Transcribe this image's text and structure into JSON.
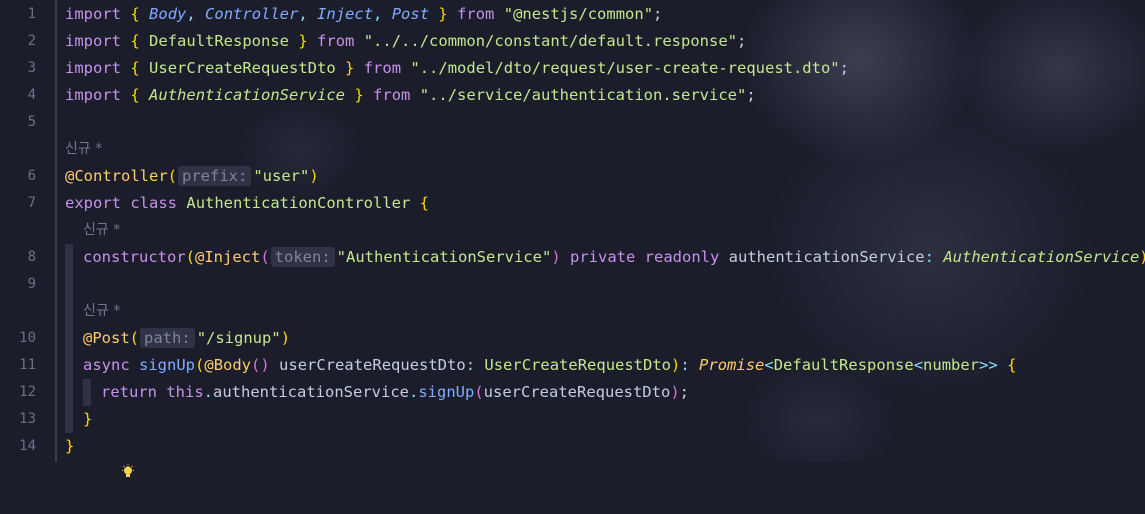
{
  "editor": {
    "line_numbers": [
      "1",
      "2",
      "3",
      "4",
      "5",
      "6",
      "7",
      "8",
      "9",
      "10",
      "11",
      "12",
      "13",
      "14"
    ],
    "codelens": "신규 *",
    "hints": {
      "prefix": "prefix:",
      "token": "token:",
      "path": "path:"
    },
    "lines": {
      "l1": {
        "import": "import",
        "brace_open": "{",
        "body": "Body",
        "controller": "Controller",
        "inject": "Inject",
        "post": "Post",
        "brace_close": "}",
        "from": "from",
        "src": "\"@nestjs/common\"",
        "semi": ";"
      },
      "l2": {
        "import": "import",
        "brace_open": "{",
        "name": "DefaultResponse",
        "brace_close": "}",
        "from": "from",
        "src": "\"../../common/constant/default.response\"",
        "semi": ";"
      },
      "l3": {
        "import": "import",
        "brace_open": "{",
        "name": "UserCreateRequestDto",
        "brace_close": "}",
        "from": "from",
        "src": "\"../model/dto/request/user-create-request.dto\"",
        "semi": ";"
      },
      "l4": {
        "import": "import",
        "brace_open": "{",
        "name": "AuthenticationService",
        "brace_close": "}",
        "from": "from",
        "src": "\"../service/authentication.service\"",
        "semi": ";"
      },
      "l6": {
        "decorator": "@Controller",
        "paren_open": "(",
        "arg": "\"user\"",
        "paren_close": ")"
      },
      "l7": {
        "export": "export",
        "class": "class",
        "name": "AuthenticationController",
        "brace": "{"
      },
      "l8": {
        "ctor": "constructor",
        "p1": "(",
        "decorator": "@Inject",
        "p2": "(",
        "arg": "\"AuthenticationService\"",
        "p3": ")",
        "private": "private",
        "readonly": "readonly",
        "param": "authenticationService",
        "colon": ":",
        "type": "AuthenticationService",
        "p4": ")",
        "body": "{}"
      },
      "l10": {
        "decorator": "@Post",
        "paren_open": "(",
        "arg": "\"/signup\"",
        "paren_close": ")"
      },
      "l11": {
        "async": "async",
        "method": "signUp",
        "p1": "(",
        "body_dec": "@Body",
        "p2": "()",
        "param": "userCreateRequestDto",
        "colon": ":",
        "type": "UserCreateRequestDto",
        "p3": ")",
        "colon2": ":",
        "promise": "Promise",
        "lt": "<",
        "dr": "DefaultResponse",
        "lt2": "<",
        "number": "number",
        "gt": ">>",
        "brace": "{"
      },
      "l12": {
        "return": "return",
        "this": "this",
        "dot1": ".",
        "svc": "authenticationService",
        "dot2": ".",
        "call": "signUp",
        "p1": "(",
        "arg": "userCreateRequestDto",
        "p2": ")",
        "semi": ";"
      },
      "l13": {
        "brace": "}"
      },
      "l14": {
        "brace": "}"
      }
    }
  }
}
